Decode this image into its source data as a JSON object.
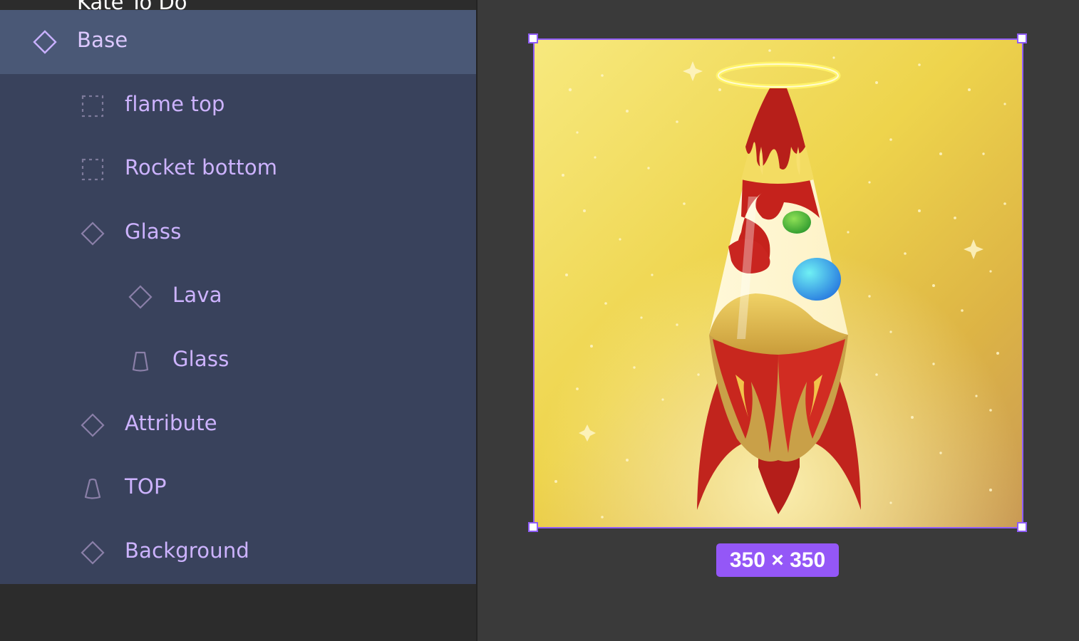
{
  "panel": {
    "title": "Kate To Do",
    "layers": [
      {
        "label": "Base",
        "icon": "component-icon",
        "selected": true
      },
      {
        "label": "flame top",
        "icon": "frame-icon"
      },
      {
        "label": "Rocket bottom",
        "icon": "frame-icon"
      },
      {
        "label": "Glass",
        "icon": "component-icon"
      },
      {
        "label": "Lava",
        "icon": "component-icon"
      },
      {
        "label": "Glass",
        "icon": "vector-icon"
      },
      {
        "label": "Attribute",
        "icon": "component-icon"
      },
      {
        "label": "TOP",
        "icon": "vector-icon"
      },
      {
        "label": "Background",
        "icon": "component-icon"
      }
    ]
  },
  "canvas": {
    "selection_size": "350 × 350",
    "colors": {
      "selection": "#8f5cf7",
      "badge": "#9457f7"
    }
  }
}
